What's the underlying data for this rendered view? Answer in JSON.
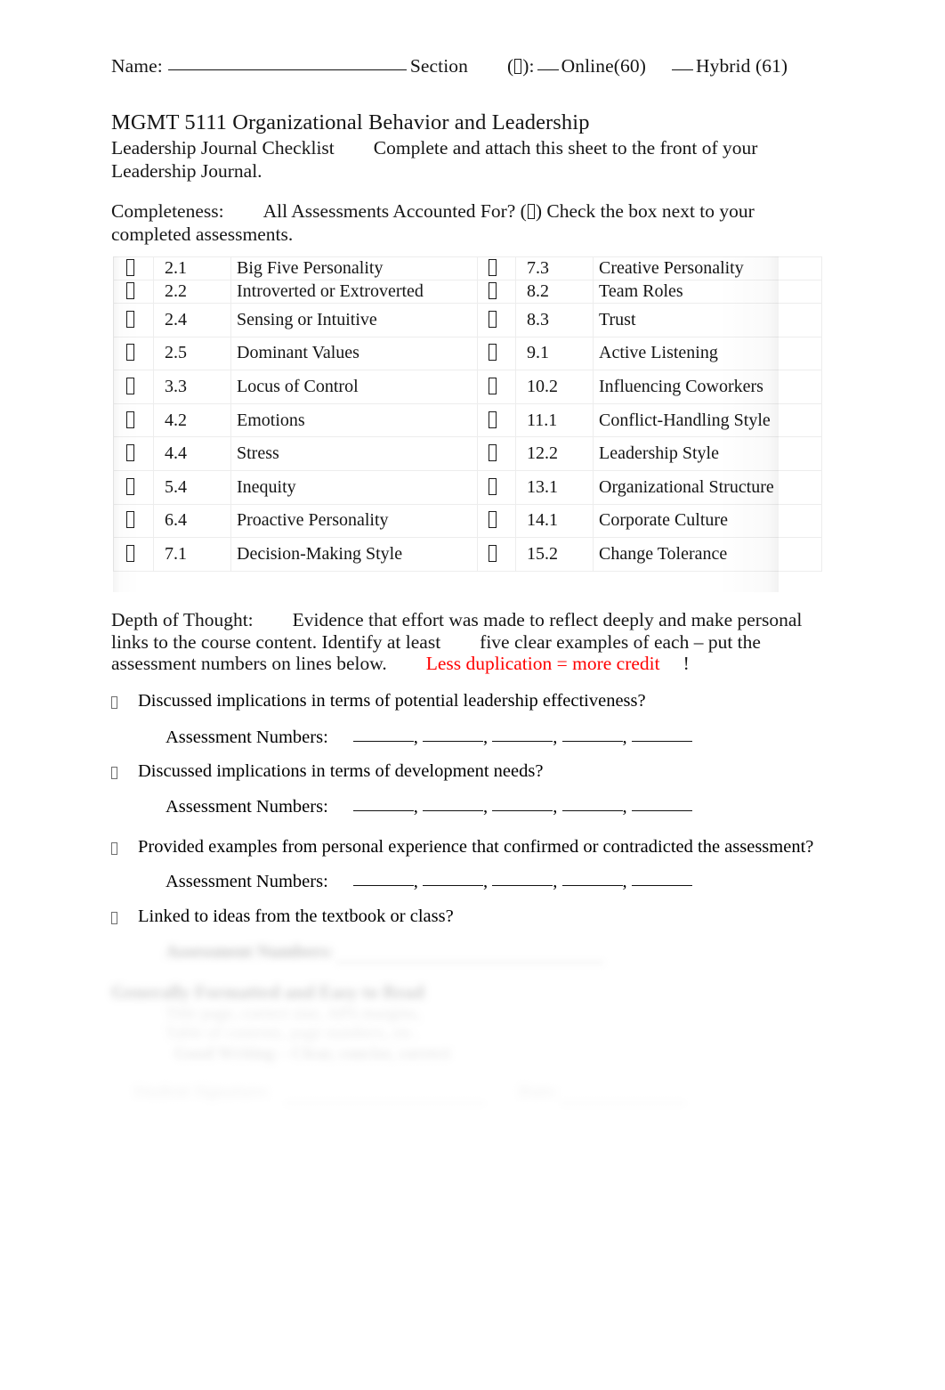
{
  "header": {
    "name_label": "Name:",
    "section_label": "Section",
    "modality_prefix": "(",
    "modality_suffix": "):",
    "online_label": "Online(60)",
    "hybrid_label": "Hybrid (61)"
  },
  "title": {
    "course": "MGMT 5111 Organizational Behavior and Leadership",
    "subtitle_left": "Leadership Journal Checklist",
    "subtitle_right": "Complete and attach this sheet to the front of your Leadership Journal."
  },
  "completeness": {
    "label": "Completeness:",
    "question": "All Assessments Accounted For? (",
    "after_glyph": ") Check the box next to your completed assessments."
  },
  "checklist": {
    "left_column": [
      {
        "number": "2.1",
        "label": "Big Five Personality"
      },
      {
        "number": "2.2",
        "label": "Introverted or Extroverted"
      },
      {
        "number": "2.4",
        "label": "Sensing or Intuitive"
      },
      {
        "number": "2.5",
        "label": "Dominant Values"
      },
      {
        "number": "3.3",
        "label": "Locus of Control"
      },
      {
        "number": "4.2",
        "label": "Emotions"
      },
      {
        "number": "4.4",
        "label": "Stress"
      },
      {
        "number": "5.4",
        "label": "Inequity"
      },
      {
        "number": "6.4",
        "label": "Proactive Personality"
      },
      {
        "number": "7.1",
        "label": "Decision-Making Style"
      }
    ],
    "right_column": [
      {
        "number": "7.3",
        "label": "Creative Personality"
      },
      {
        "number": "8.2",
        "label": "Team Roles"
      },
      {
        "number": "8.3",
        "label": "Trust"
      },
      {
        "number": "9.1",
        "label": "Active Listening"
      },
      {
        "number": "10.2",
        "label": "Influencing Coworkers"
      },
      {
        "number": "11.1",
        "label": "Conflict-Handling Style"
      },
      {
        "number": "12.2",
        "label": "Leadership Style"
      },
      {
        "number": "13.1",
        "label": "Organizational Structure"
      },
      {
        "number": "14.1",
        "label": "Corporate Culture"
      },
      {
        "number": "15.2",
        "label": "Change Tolerance"
      }
    ]
  },
  "depth": {
    "label": "Depth of Thought:",
    "body_part1": "Evidence that effort was made to reflect deeply and make personal links to the course content. Identify at least",
    "body_part2": "five clear examples of each – put the assessment numbers on lines below.",
    "highlight": "Less duplication = more credit",
    "exclaim": "!",
    "accent_color": "#ff0000"
  },
  "questions": [
    {
      "text": "Discussed implications in terms of potential leadership effectiveness?",
      "has_numbers": true
    },
    {
      "text": "Discussed implications in terms of development needs?",
      "has_numbers": true
    },
    {
      "text": "Provided examples from personal experience that confirmed or contradicted the assessment?",
      "has_numbers": true
    },
    {
      "text": "Linked to ideas from the textbook or class?",
      "has_numbers": true
    }
  ],
  "assessment_numbers_label": "Assessment Numbers:",
  "faded_bottom": {
    "assessment_numbers_label": "Assessment Numbers:",
    "heading": "Generally Formatted and Easy to Read",
    "line_a": "Title page, correct size, APA margins,",
    "line_b": "Table of contents, page numbers, etc.",
    "line_c": "Good Writing – Clear, concise, correct",
    "signature_label": "Student Signature:",
    "date_label": "Date:"
  }
}
